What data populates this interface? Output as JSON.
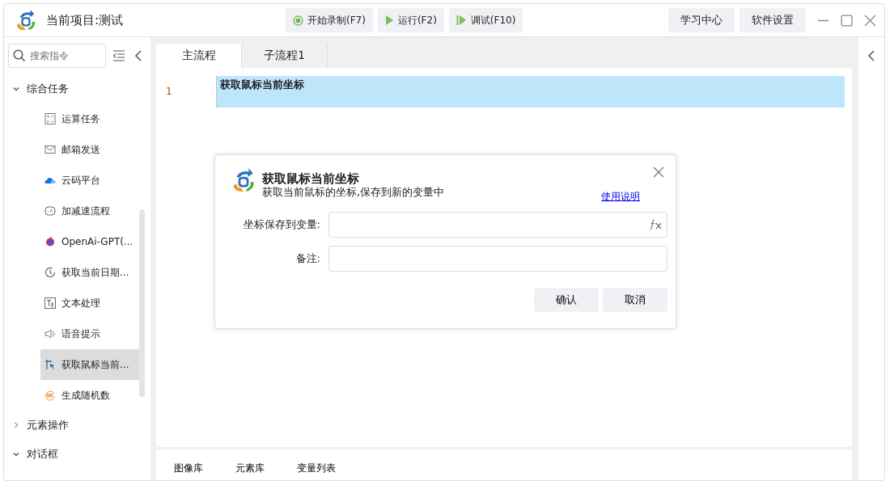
{
  "window": {
    "title": "当前项目:测试"
  },
  "toolbar": [
    {
      "label": "开始录制(F7)",
      "kind": "record"
    },
    {
      "label": "运行(F2)",
      "kind": "run"
    },
    {
      "label": "调试(F10)",
      "kind": "debug"
    }
  ],
  "top_buttons": [
    "学习中心",
    "软件设置"
  ],
  "sidebar": {
    "search": {
      "placeholder": "搜索指令"
    },
    "groups": [
      {
        "label": "综合任务",
        "expanded": true,
        "children": [
          {
            "label": "运算任务",
            "selected": false
          },
          {
            "label": "邮箱发送",
            "selected": false
          },
          {
            "label": "云码平台",
            "selected": false
          },
          {
            "label": "加减速流程",
            "selected": false
          },
          {
            "label": "OpenAi-GPT(...",
            "selected": false
          },
          {
            "label": "获取当前日期...",
            "selected": false
          },
          {
            "label": "文本处理",
            "selected": false
          },
          {
            "label": "语音提示",
            "selected": false
          },
          {
            "label": "获取鼠标当前...",
            "selected": true
          },
          {
            "label": "生成随机数",
            "selected": false
          }
        ]
      },
      {
        "label": "元素操作",
        "expanded": false
      },
      {
        "label": "对话框",
        "expanded": true
      }
    ]
  },
  "tabs": [
    {
      "label": "主流程",
      "selected": true
    },
    {
      "label": "子流程1",
      "selected": false
    }
  ],
  "code_lines": [
    {
      "number": "1",
      "text": "获取鼠标当前坐标",
      "selected": true
    }
  ],
  "dialog": {
    "title": "获取鼠标当前坐标",
    "description": "获取当前鼠标的坐标,保存到新的变量中",
    "help_link": "使用说明",
    "fields": [
      {
        "label": "坐标保存到变量:",
        "kind": "formula"
      },
      {
        "label": "备注:",
        "kind": "plain"
      }
    ],
    "buttons": [
      "确认",
      "取消"
    ]
  },
  "bottom_tabs": [
    "图像库",
    "元素库",
    "变量列表"
  ]
}
